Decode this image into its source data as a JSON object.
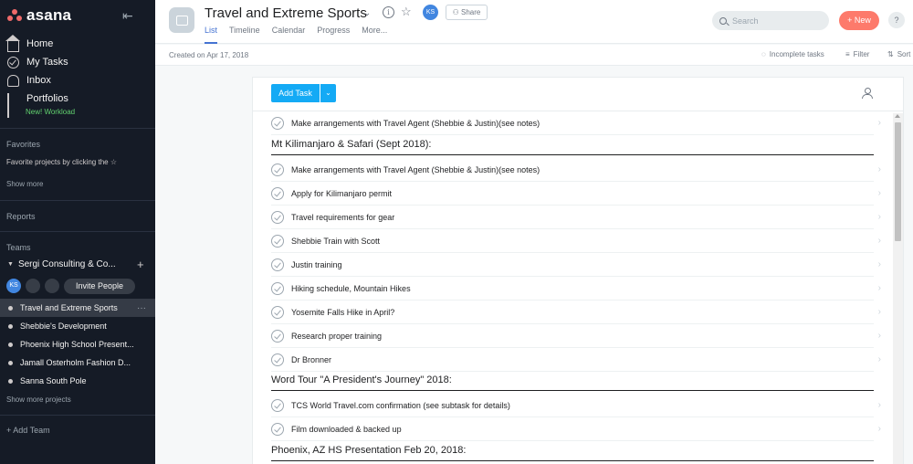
{
  "sidebar": {
    "logo": "asana",
    "nav": [
      {
        "label": "Home",
        "icon": "home-icon"
      },
      {
        "label": "My Tasks",
        "icon": "check-circle-icon"
      },
      {
        "label": "Inbox",
        "icon": "bell-icon"
      },
      {
        "label": "Portfolios",
        "icon": "bar-chart-icon"
      }
    ],
    "workload_label": "New! Workload",
    "favorites_title": "Favorites",
    "favorites_hint": "Favorite projects by clicking the",
    "favorites_show_more": "Show more",
    "reports_title": "Reports",
    "teams_title": "Teams",
    "team_name": "Sergi Consulting & Co...",
    "team_member_initials": "KS",
    "invite_label": "Invite People",
    "projects": [
      {
        "name": "Travel and Extreme Sports",
        "active": true
      },
      {
        "name": "Shebbie's Development",
        "active": false
      },
      {
        "name": "Phoenix High School Present...",
        "active": false
      },
      {
        "name": "Jamall Osterholm Fashion D...",
        "active": false
      },
      {
        "name": "Sanna South Pole",
        "active": false
      }
    ],
    "projects_show_more": "Show more projects",
    "add_team": "Add Team"
  },
  "header": {
    "title": "Travel and Extreme Sports",
    "owner_initials": "KS",
    "share_label": "Share",
    "tabs": [
      "List",
      "Timeline",
      "Calendar",
      "Progress",
      "More..."
    ],
    "search_placeholder": "Search",
    "new_label": "New",
    "help_label": "?"
  },
  "toolbar": {
    "created": "Created on Apr 17, 2018",
    "incomplete": "Incomplete tasks",
    "filter": "Filter",
    "sort": "Sort"
  },
  "list": {
    "add_task": "Add Task",
    "rows": [
      {
        "type": "task",
        "text": "Make arrangements with Travel Agent (Shebbie & Justin)(see notes)"
      },
      {
        "type": "section",
        "text": "Mt Kilimanjaro & Safari (Sept 2018):"
      },
      {
        "type": "task",
        "text": "Make arrangements with Travel Agent (Shebbie & Justin)(see notes)"
      },
      {
        "type": "task",
        "text": "Apply for Kilimanjaro permit"
      },
      {
        "type": "task",
        "text": "Travel requirements for gear"
      },
      {
        "type": "task",
        "text": "Shebbie Train with Scott"
      },
      {
        "type": "task",
        "text": "Justin training"
      },
      {
        "type": "task",
        "text": "Hiking schedule, Mountain Hikes"
      },
      {
        "type": "task",
        "text": "Yosemite Falls Hike in April?"
      },
      {
        "type": "task",
        "text": "Research proper training"
      },
      {
        "type": "task",
        "text": "Dr Bronner"
      },
      {
        "type": "section",
        "text": "Word Tour \"A President's Journey\" 2018:"
      },
      {
        "type": "task",
        "text": "TCS World Travel.com confirmation (see subtask for details)"
      },
      {
        "type": "task",
        "text": "Film downloaded & backed up"
      },
      {
        "type": "section",
        "text": "Phoenix, AZ HS Presentation Feb 20, 2018:"
      }
    ]
  },
  "colors": {
    "sidebar_bg": "#151b26",
    "accent_blue": "#14aaf5",
    "new_button": "#fd7a6b",
    "tab_active": "#4573d2",
    "workload_green": "#62d26f"
  }
}
